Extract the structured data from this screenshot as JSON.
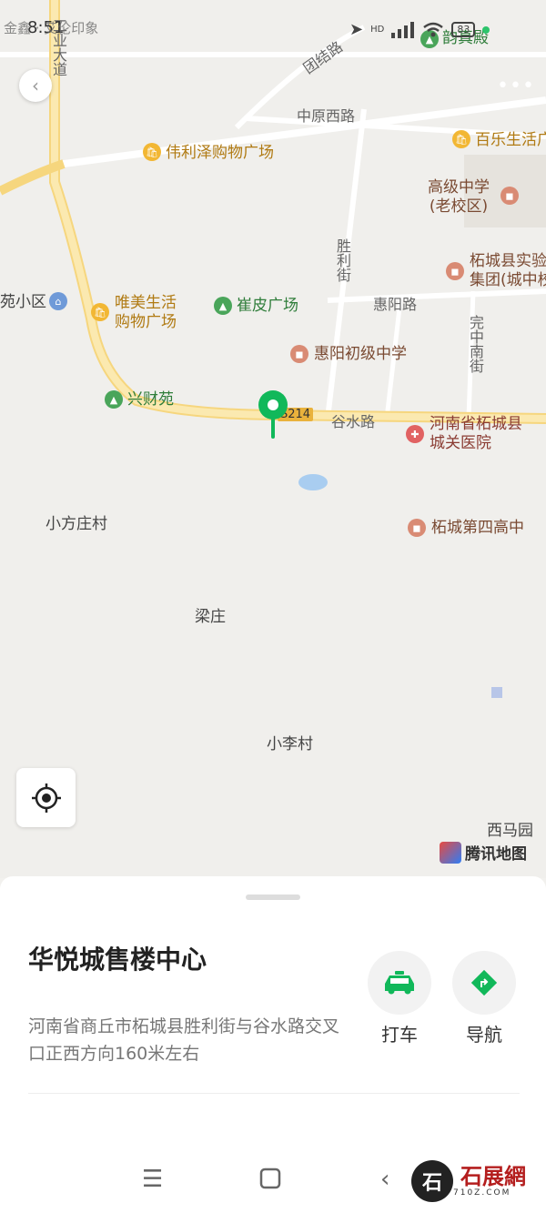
{
  "status_bar": {
    "time": "8:51",
    "notif_text": "金鑫 · 艾伦印象",
    "network": "HD",
    "battery": "83"
  },
  "map": {
    "roads": [
      "工业大道",
      "团结路",
      "中原西路",
      "胜利街",
      "惠阳路",
      "完中南街",
      "谷水路"
    ],
    "route_badge": "S214",
    "places": {
      "weili": "伟利泽购物广场",
      "baile": "百乐生活广",
      "gaoji": "高级中学\n(老校区)",
      "shiyan": "柘城县实验\n集团(城中校",
      "yuanxiaoqu": "苑小区",
      "weimei": "唯美生活\n购物广场",
      "cuipi": "崔皮广场",
      "huiyang": "惠阳初级中学",
      "xingcai": "兴财苑",
      "yiyuan": "河南省柘城县\n城关医院",
      "xiaofang": "小方庄村",
      "disigao": "柘城第四高中",
      "liangzhuang": "梁庄",
      "xiaoli": "小李村",
      "ximayuan": "西马园",
      "nankai": "韵真殿"
    },
    "brand": "腾讯地图"
  },
  "sheet": {
    "title": "华悦城售楼中心",
    "address": "河南省商丘市柘城县胜利街与谷水路交叉口正西方向160米左右",
    "actions": {
      "taxi": "打车",
      "nav": "导航"
    }
  },
  "watermark": {
    "seal": "石",
    "name": "石展網",
    "sub": "710Z.COM"
  },
  "colors": {
    "accent": "#11b85a",
    "map_bg": "#f0efec",
    "road": "#ffffff",
    "main_road": "#f7dc8a"
  }
}
